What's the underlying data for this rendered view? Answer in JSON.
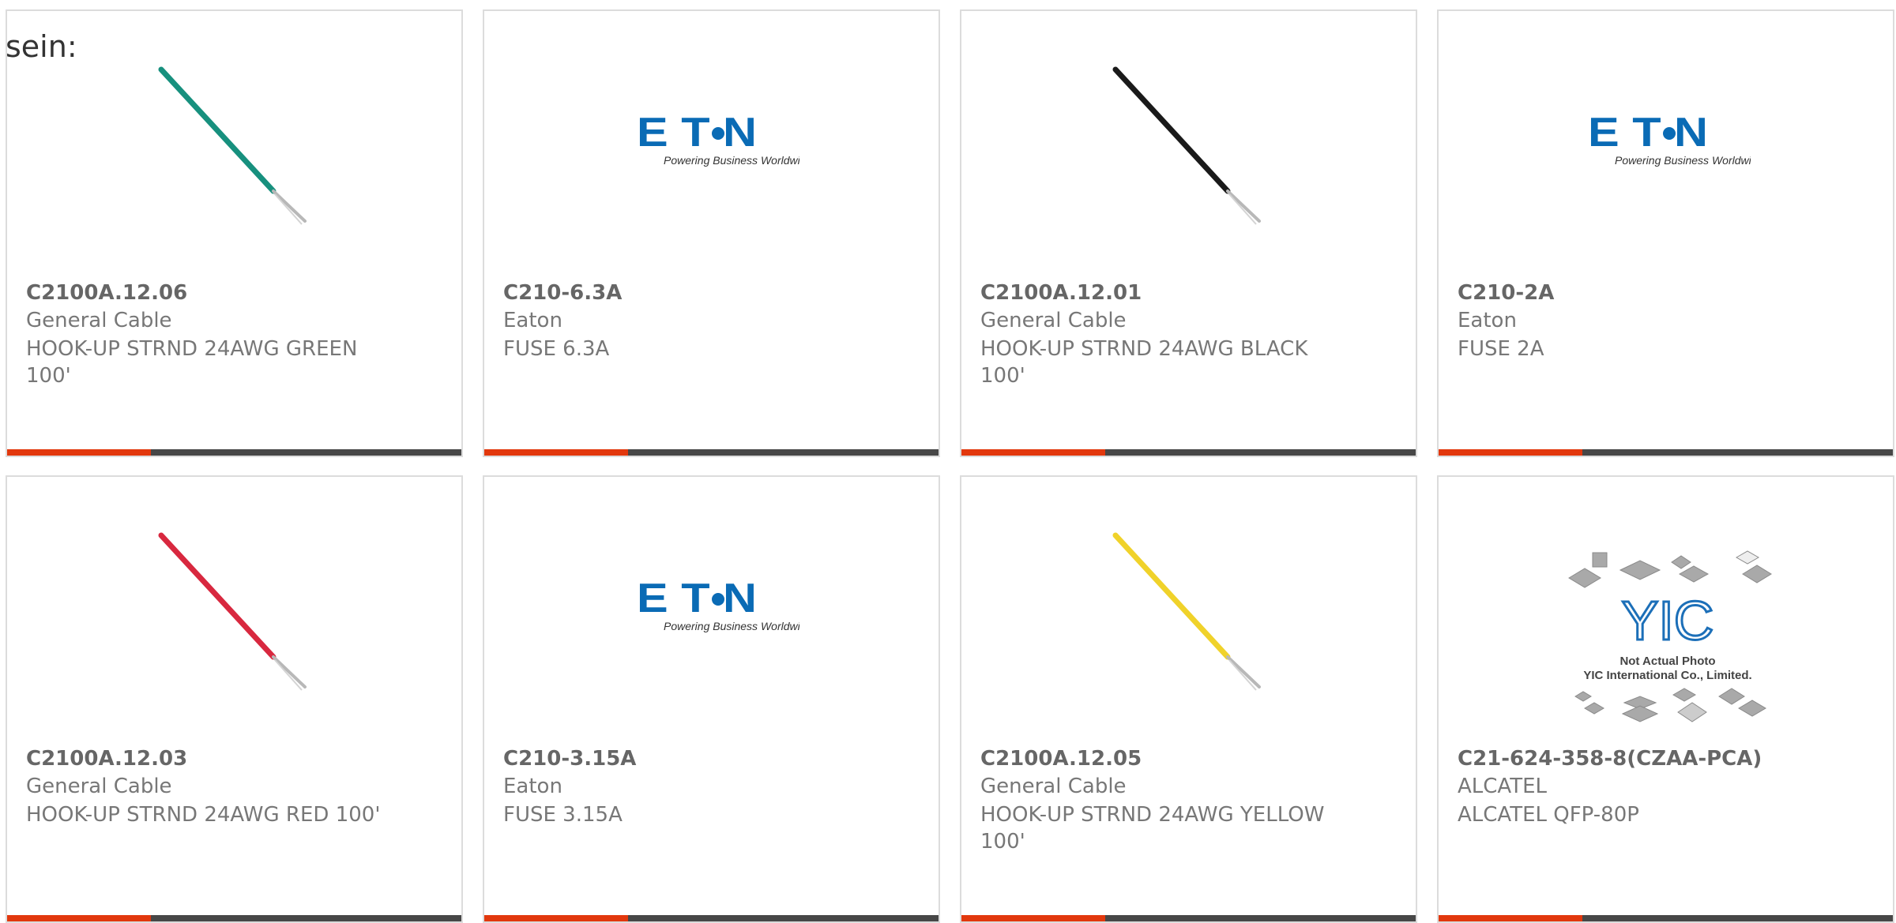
{
  "page": {
    "intro_text": "sein:"
  },
  "colors": {
    "accent": "#e2380d",
    "bar": "#474747",
    "eaton_blue": "#0a6bb5"
  },
  "products": [
    {
      "part_number": "C2100A.12.06",
      "manufacturer": "General Cable",
      "description": "HOOK-UP STRND 24AWG GREEN 100'",
      "image": "wire",
      "wire_color": "#17907e"
    },
    {
      "part_number": "C210-6.3A",
      "manufacturer": "Eaton",
      "description": "FUSE 6.3A",
      "image": "eaton-logo",
      "logo_text": "E T N",
      "logo_tagline": "Powering Business Worldwide"
    },
    {
      "part_number": "C2100A.12.01",
      "manufacturer": "General Cable",
      "description": "HOOK-UP STRND 24AWG BLACK 100'",
      "image": "wire",
      "wire_color": "#1a1a1a"
    },
    {
      "part_number": "C210-2A",
      "manufacturer": "Eaton",
      "description": "FUSE 2A",
      "image": "eaton-logo",
      "logo_text": "E T N",
      "logo_tagline": "Powering Business Worldwide"
    },
    {
      "part_number": "C2100A.12.03",
      "manufacturer": "General Cable",
      "description": "HOOK-UP STRND 24AWG RED 100'",
      "image": "wire",
      "wire_color": "#d8283f"
    },
    {
      "part_number": "C210-3.15A",
      "manufacturer": "Eaton",
      "description": "FUSE 3.15A",
      "image": "eaton-logo",
      "logo_text": "E T N",
      "logo_tagline": "Powering Business Worldwide"
    },
    {
      "part_number": "C2100A.12.05",
      "manufacturer": "General Cable",
      "description": "HOOK-UP STRND 24AWG YELLOW 100'",
      "image": "wire",
      "wire_color": "#f0d22a"
    },
    {
      "part_number": "C21-624-358-8(CZAA-PCA)",
      "manufacturer": "ALCATEL",
      "description": "ALCATEL QFP-80P",
      "image": "yic-placeholder",
      "logo_text": "YIC",
      "placeholder_line1": "Not Actual Photo",
      "placeholder_line2": "YIC International Co., Limited."
    }
  ]
}
